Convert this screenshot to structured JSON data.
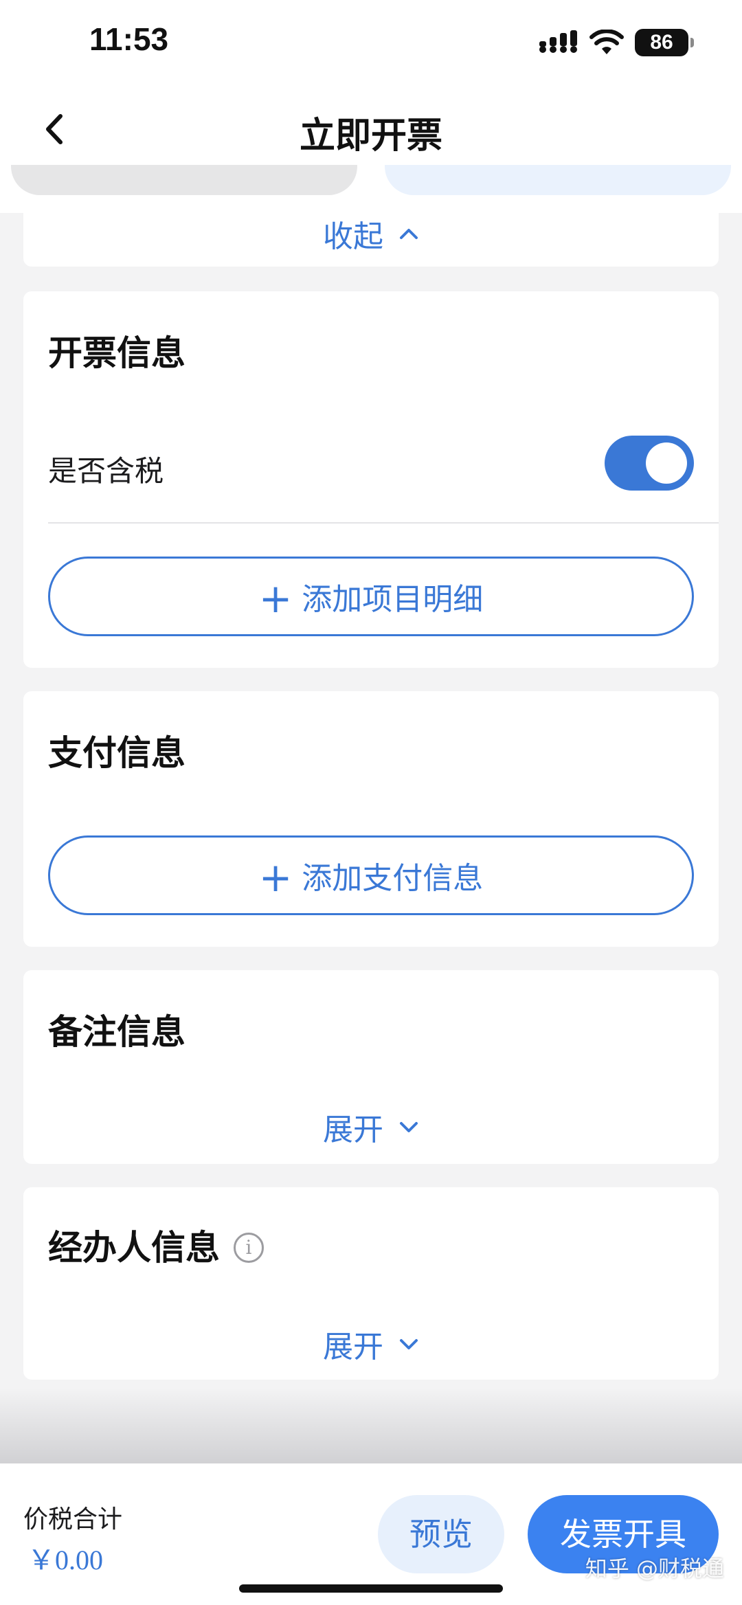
{
  "status_bar": {
    "time": "11:53",
    "battery": "86"
  },
  "nav": {
    "title": "立即开票",
    "back_icon": "chevron-left-icon"
  },
  "top_card": {
    "collapse_label": "收起"
  },
  "invoice_info": {
    "title": "开票信息",
    "tax_included_label": "是否含税",
    "tax_included": true,
    "add_item_label": "添加项目明细"
  },
  "payment_info": {
    "title": "支付信息",
    "add_payment_label": "添加支付信息"
  },
  "remark_info": {
    "title": "备注信息",
    "expand_label": "展开"
  },
  "handler_info": {
    "title": "经办人信息",
    "info_icon": "info-icon",
    "expand_label": "展开"
  },
  "footer": {
    "total_label": "价税合计",
    "total_value": "￥0.00",
    "preview_label": "预览",
    "issue_label": "发票开具",
    "watermark": "知乎 @财税通"
  },
  "colors": {
    "accent": "#3a78d6",
    "primary_button": "#3b82f0",
    "background": "#f3f3f4"
  }
}
